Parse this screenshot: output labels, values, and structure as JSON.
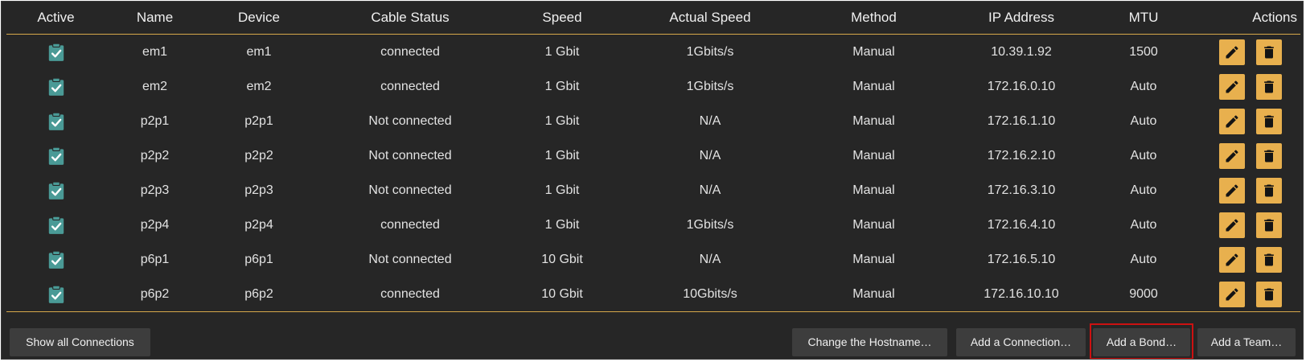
{
  "table": {
    "headers": {
      "active": "Active",
      "name": "Name",
      "device": "Device",
      "cable_status": "Cable Status",
      "speed": "Speed",
      "actual_speed": "Actual Speed",
      "method": "Method",
      "ip_address": "IP Address",
      "mtu": "MTU",
      "actions": "Actions"
    },
    "rows": [
      {
        "active": true,
        "name": "em1",
        "device": "em1",
        "cable_status": "connected",
        "speed": "1 Gbit",
        "actual_speed": "1Gbits/s",
        "method": "Manual",
        "ip": "10.39.1.92",
        "mtu": "1500"
      },
      {
        "active": true,
        "name": "em2",
        "device": "em2",
        "cable_status": "connected",
        "speed": "1 Gbit",
        "actual_speed": "1Gbits/s",
        "method": "Manual",
        "ip": "172.16.0.10",
        "mtu": "Auto"
      },
      {
        "active": true,
        "name": "p2p1",
        "device": "p2p1",
        "cable_status": "Not connected",
        "speed": "1 Gbit",
        "actual_speed": "N/A",
        "method": "Manual",
        "ip": "172.16.1.10",
        "mtu": "Auto"
      },
      {
        "active": true,
        "name": "p2p2",
        "device": "p2p2",
        "cable_status": "Not connected",
        "speed": "1 Gbit",
        "actual_speed": "N/A",
        "method": "Manual",
        "ip": "172.16.2.10",
        "mtu": "Auto"
      },
      {
        "active": true,
        "name": "p2p3",
        "device": "p2p3",
        "cable_status": "Not connected",
        "speed": "1 Gbit",
        "actual_speed": "N/A",
        "method": "Manual",
        "ip": "172.16.3.10",
        "mtu": "Auto"
      },
      {
        "active": true,
        "name": "p2p4",
        "device": "p2p4",
        "cable_status": "connected",
        "speed": "1 Gbit",
        "actual_speed": "1Gbits/s",
        "method": "Manual",
        "ip": "172.16.4.10",
        "mtu": "Auto"
      },
      {
        "active": true,
        "name": "p6p1",
        "device": "p6p1",
        "cable_status": "Not connected",
        "speed": "10 Gbit",
        "actual_speed": "N/A",
        "method": "Manual",
        "ip": "172.16.5.10",
        "mtu": "Auto"
      },
      {
        "active": true,
        "name": "p6p2",
        "device": "p6p2",
        "cable_status": "connected",
        "speed": "10 Gbit",
        "actual_speed": "10Gbits/s",
        "method": "Manual",
        "ip": "172.16.10.10",
        "mtu": "9000"
      }
    ]
  },
  "footer": {
    "show_all": "Show all Connections",
    "change_hostname": "Change the Hostname…",
    "add_connection": "Add a Connection…",
    "add_bond": "Add a Bond…",
    "add_team": "Add a Team…"
  },
  "icons": {
    "active": "clipboard-check-icon",
    "edit": "pencil-icon",
    "delete": "trash-icon"
  },
  "colors": {
    "panel_bg": "#262626",
    "accent": "#e8b04e",
    "check_icon": "#4a9a96",
    "button_bg": "#3d3d3d",
    "highlight": "#cc1111"
  }
}
